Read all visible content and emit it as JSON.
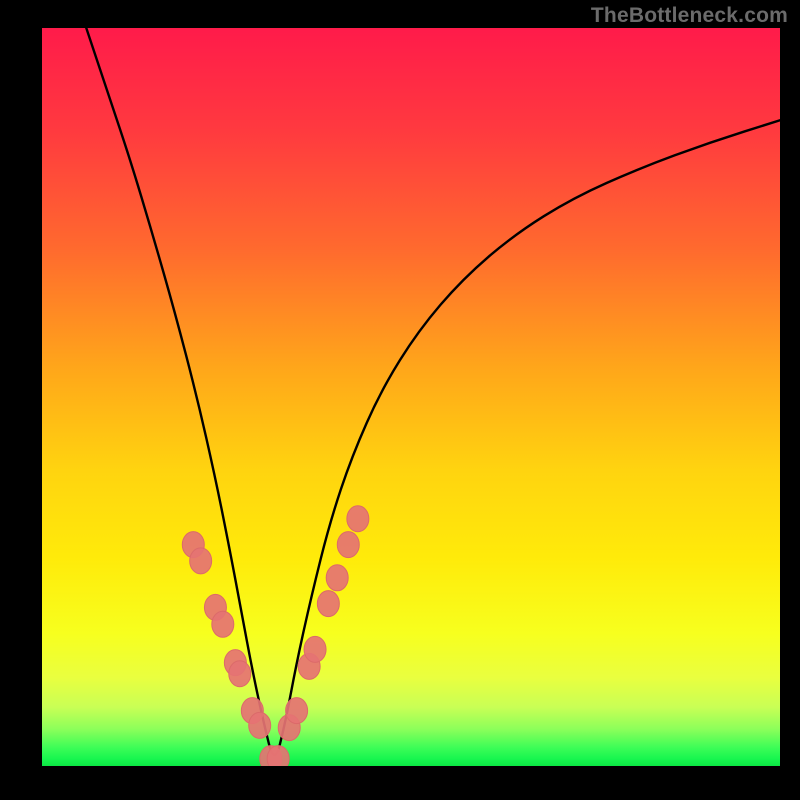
{
  "watermark": "TheBottleneck.com",
  "colors": {
    "frame_background": "#000000",
    "curve_stroke": "#000000",
    "marker_fill": "#e57373",
    "marker_stroke": "#dc6a6a",
    "watermark_text": "#6b6b6b"
  },
  "chart_data": {
    "type": "line",
    "title": "",
    "xlabel": "",
    "ylabel": "",
    "xlim": [
      0,
      1
    ],
    "ylim": [
      0,
      1
    ],
    "legend": false,
    "annotations": [
      "TheBottleneck.com"
    ],
    "description": "V-shaped bottleneck curve over red→green vertical gradient. Curve descends steeply from top-left, reaches a minimum near x≈0.31 at the bottom, then rises with decreasing slope toward the upper-right. A cluster of soft coral markers sits along the curve near the minimum on both sides.",
    "series": [
      {
        "name": "bottleneck-curve",
        "x": [
          0.06,
          0.09,
          0.12,
          0.15,
          0.18,
          0.21,
          0.235,
          0.255,
          0.27,
          0.285,
          0.3,
          0.315,
          0.33,
          0.345,
          0.365,
          0.39,
          0.42,
          0.46,
          0.51,
          0.57,
          0.64,
          0.72,
          0.81,
          0.905,
          1.0
        ],
        "y": [
          1.0,
          0.91,
          0.82,
          0.72,
          0.615,
          0.5,
          0.39,
          0.29,
          0.21,
          0.13,
          0.06,
          0.0,
          0.06,
          0.14,
          0.23,
          0.33,
          0.42,
          0.51,
          0.59,
          0.66,
          0.72,
          0.77,
          0.81,
          0.845,
          0.875
        ]
      }
    ],
    "markers": {
      "name": "highlight-dots",
      "x": [
        0.205,
        0.215,
        0.235,
        0.245,
        0.262,
        0.268,
        0.285,
        0.295,
        0.31,
        0.32,
        0.335,
        0.345,
        0.362,
        0.37,
        0.388,
        0.4,
        0.415,
        0.428
      ],
      "y": [
        0.3,
        0.278,
        0.215,
        0.192,
        0.14,
        0.125,
        0.075,
        0.055,
        0.01,
        0.01,
        0.052,
        0.075,
        0.135,
        0.158,
        0.22,
        0.255,
        0.3,
        0.335
      ]
    }
  }
}
